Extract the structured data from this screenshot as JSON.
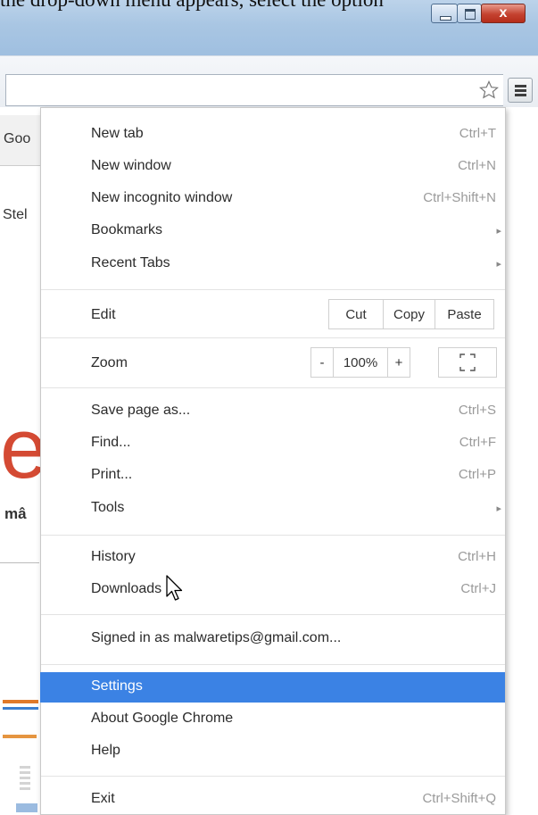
{
  "caption": "the drop-down menu appears, select the option",
  "window_buttons": {
    "close_glyph": "x"
  },
  "page_background": {
    "tab_fragment": "Goo",
    "text_fragment_1": "Stel",
    "logo_fragment": "e",
    "text_fragment_2": "mâ"
  },
  "menu": {
    "new_tab": {
      "label": "New tab",
      "shortcut": "Ctrl+T"
    },
    "new_window": {
      "label": "New window",
      "shortcut": "Ctrl+N"
    },
    "new_incognito": {
      "label": "New incognito window",
      "shortcut": "Ctrl+Shift+N"
    },
    "bookmarks": {
      "label": "Bookmarks"
    },
    "recent_tabs": {
      "label": "Recent Tabs"
    },
    "edit": {
      "label": "Edit",
      "cut": "Cut",
      "copy": "Copy",
      "paste": "Paste"
    },
    "zoom": {
      "label": "Zoom",
      "minus": "-",
      "level": "100%",
      "plus": "+"
    },
    "save_page": {
      "label": "Save page as...",
      "shortcut": "Ctrl+S"
    },
    "find": {
      "label": "Find...",
      "shortcut": "Ctrl+F"
    },
    "print": {
      "label": "Print...",
      "shortcut": "Ctrl+P"
    },
    "tools": {
      "label": "Tools"
    },
    "history": {
      "label": "History",
      "shortcut": "Ctrl+H"
    },
    "downloads": {
      "label": "Downloads",
      "shortcut": "Ctrl+J"
    },
    "signed_in": {
      "label": "Signed in as malwaretips@gmail.com..."
    },
    "settings": {
      "label": "Settings",
      "highlighted": true
    },
    "about": {
      "label": "About Google Chrome"
    },
    "help": {
      "label": "Help"
    },
    "exit": {
      "label": "Exit",
      "shortcut": "Ctrl+Shift+Q"
    },
    "submenu_arrow": "▸"
  },
  "colors": {
    "highlight": "#3b82e4",
    "logo_red": "#d44a33"
  }
}
